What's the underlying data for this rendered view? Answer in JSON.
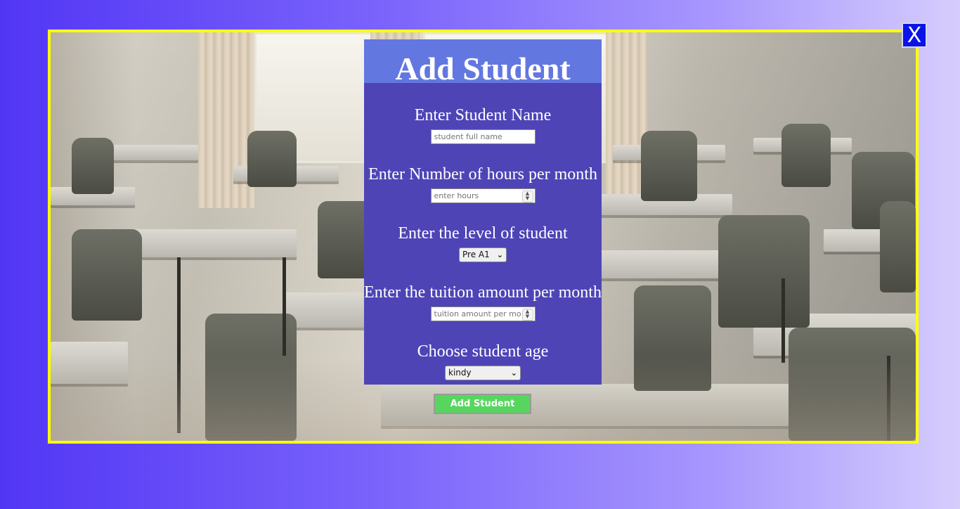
{
  "window": {
    "close_label": "X"
  },
  "form": {
    "title": "Add Student",
    "fields": {
      "name": {
        "label": "Enter Student Name",
        "placeholder": "student full name"
      },
      "hours": {
        "label": "Enter Number of hours per month",
        "placeholder": "enter hours"
      },
      "level": {
        "label": "Enter the level of student",
        "selected": "Pre A1"
      },
      "tuition": {
        "label": "Enter the tuition amount per month",
        "placeholder": "tuition amount per mo"
      },
      "age": {
        "label": "Choose student age",
        "selected": "kindy"
      }
    },
    "submit_label": "Add Student"
  },
  "colors": {
    "frame_border": "#ffff00",
    "panel_bg": "#4e44b6",
    "header_bg": "#6377e0",
    "submit_bg": "#57d65e",
    "close_bg": "#0a14e8"
  },
  "icons": {
    "close": "close-icon",
    "chevron": "chevron-down-icon",
    "spinner": "spinner-arrows-icon"
  }
}
